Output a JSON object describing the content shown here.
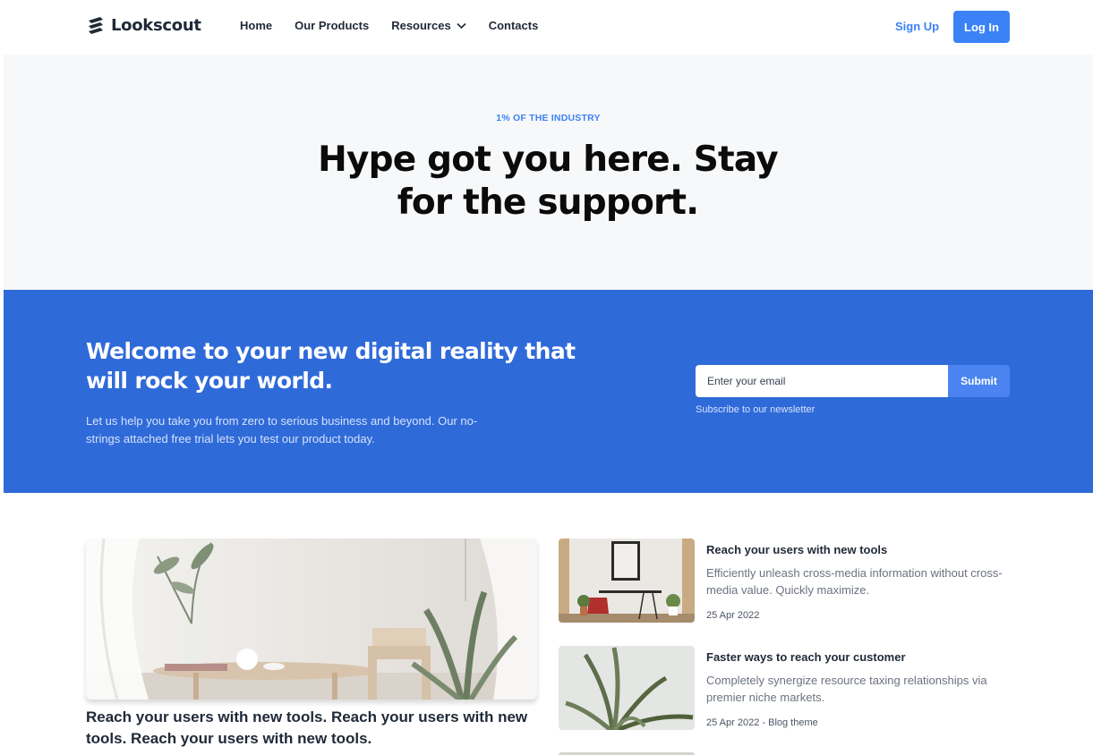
{
  "nav": {
    "brand": "Lookscout",
    "links": [
      "Home",
      "Our Products",
      "Resources",
      "Contacts"
    ],
    "signup": "Sign Up",
    "login": "Log In"
  },
  "hero": {
    "eyebrow": "1% OF THE INDUSTRY",
    "title_line1": "Hype got you here. Stay",
    "title_line2": "for the support."
  },
  "newsletter": {
    "title": "Welcome to your new digital reality that will rock your world.",
    "text": "Let us help you take you from zero to serious business and beyond. Our no-strings attached free trial lets you test our product today.",
    "email_placeholder": "Enter your email",
    "submit": "Submit",
    "note": "Subscribe to our newsletter"
  },
  "blog": {
    "featured_title": "Reach your users with new tools. Reach your users with new tools. Reach your users with new tools.",
    "posts": [
      {
        "title": "Reach your users with new tools",
        "desc": "Efficiently unleash cross-media information without cross-media value. Quickly maximize.",
        "meta": "25 Apr 2022"
      },
      {
        "title": "Faster ways to reach your customer",
        "desc": "Completely synergize resource taxing relationships via premier niche markets.",
        "meta": "25 Apr 2022 - Blog theme"
      }
    ]
  },
  "colors": {
    "accent": "#3b82f6",
    "band": "#2f6ad9",
    "hero_bg": "#f7f8fa"
  }
}
